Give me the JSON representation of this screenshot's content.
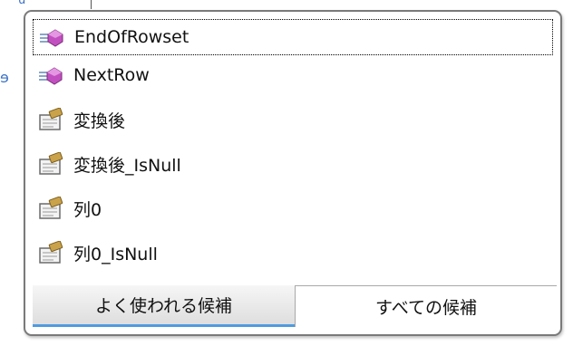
{
  "background": {
    "top_fragment": "u",
    "left_fragment": "ɘ"
  },
  "completion_list": {
    "items": [
      {
        "label": "EndOfRowset",
        "icon": "method-icon",
        "selected": true
      },
      {
        "label": "NextRow",
        "icon": "method-icon",
        "selected": false
      },
      {
        "label": "変換後",
        "icon": "property-icon",
        "selected": false
      },
      {
        "label": "変換後_IsNull",
        "icon": "property-icon",
        "selected": false
      },
      {
        "label": "列0",
        "icon": "property-icon",
        "selected": false
      },
      {
        "label": "列0_IsNull",
        "icon": "property-icon",
        "selected": false
      }
    ],
    "tabs": {
      "common": "よく使われる候補",
      "all": "すべての候補"
    }
  },
  "colors": {
    "method_icon": "#c24fc0",
    "property_icon": "#c9a24a",
    "tab_accent": "#4f9be0"
  }
}
